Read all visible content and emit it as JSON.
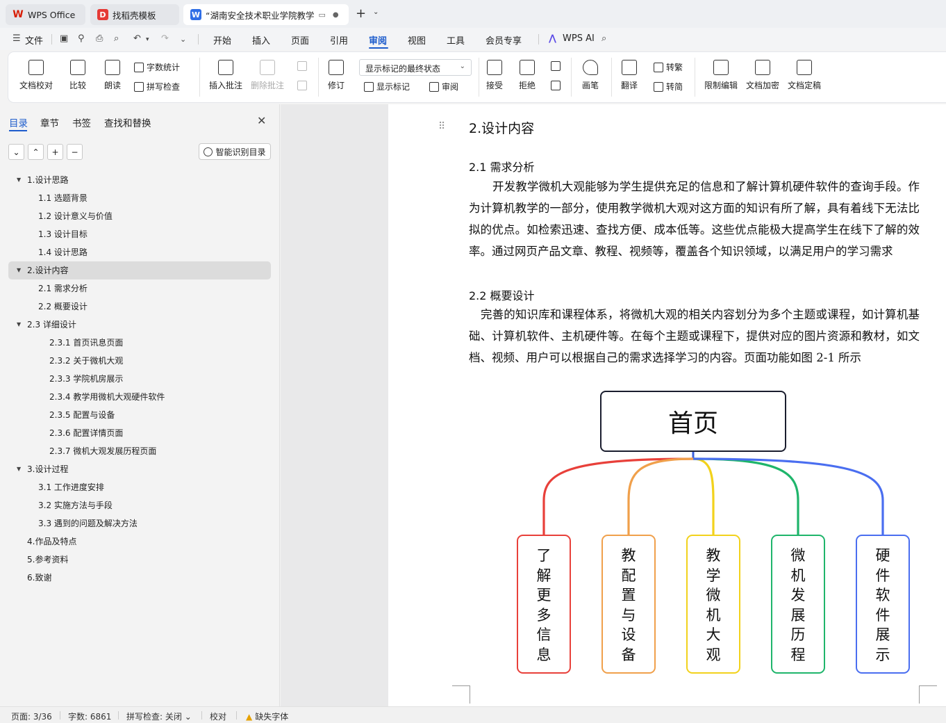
{
  "tabs": [
    {
      "label": "WPS Office",
      "icon": "wps-logo-icon"
    },
    {
      "label": "找稻壳模板",
      "icon": "docer-icon"
    },
    {
      "label": "“湖南安全技术职业学院教学",
      "icon": "word-doc-icon"
    }
  ],
  "menu": {
    "file": "文件",
    "items": [
      "开始",
      "插入",
      "页面",
      "引用",
      "审阅",
      "视图",
      "工具",
      "会员专享"
    ],
    "active": "审阅",
    "ai": "WPS AI"
  },
  "ribbon": {
    "doc_check": "文档校对",
    "compare": "比较",
    "read_aloud": "朗读",
    "word_count": "字数统计",
    "spell_check": "拼写检查",
    "insert_comment": "插入批注",
    "delete_comment": "删除批注",
    "revise": "修订",
    "display_mode": "显示标记的最终状态",
    "show_markup": "显示标记",
    "review": "审阅",
    "accept": "接受",
    "reject": "拒绝",
    "pen": "画笔",
    "translate": "翻译",
    "to_traditional": "转繁",
    "to_simplified": "转简",
    "restrict_edit": "限制编辑",
    "encrypt": "文档加密",
    "finalize": "文档定稿"
  },
  "nav": {
    "tabs": [
      "目录",
      "章节",
      "书签",
      "查找和替换"
    ],
    "smart_toc": "智能识别目录",
    "toc": [
      {
        "text": "1.设计思路",
        "level": 1,
        "expanded": true
      },
      {
        "text": "1.1 选题背景",
        "level": 2
      },
      {
        "text": "1.2 设计意义与价值",
        "level": 2
      },
      {
        "text": "1.3 设计目标",
        "level": 2
      },
      {
        "text": "1.4 设计思路",
        "level": 2
      },
      {
        "text": "2.设计内容",
        "level": 1,
        "expanded": true,
        "selected": true
      },
      {
        "text": "2.1 需求分析",
        "level": 2
      },
      {
        "text": "2.2 概要设计",
        "level": 2
      },
      {
        "text": "2.3 详细设计",
        "level": 1,
        "expanded": true
      },
      {
        "text": "2.3.1 首页讯息页面",
        "level": 3
      },
      {
        "text": "2.3.2 关于微机大观",
        "level": 3
      },
      {
        "text": "2.3.3 学院机房展示",
        "level": 3
      },
      {
        "text": "2.3.4 教学用微机大观硬件软件",
        "level": 3
      },
      {
        "text": "2.3.5 配置与设备",
        "level": 3
      },
      {
        "text": "2.3.6 配置详情页面",
        "level": 3
      },
      {
        "text": "2.3.7 微机大观发展历程页面",
        "level": 3
      },
      {
        "text": "3.设计过程",
        "level": 1,
        "expanded": true
      },
      {
        "text": "3.1 工作进度安排",
        "level": 2
      },
      {
        "text": "3.2 实施方法与手段",
        "level": 2
      },
      {
        "text": "3.3 遇到的问题及解决方法",
        "level": 2
      },
      {
        "text": "4.作品及特点",
        "level": 1
      },
      {
        "text": "5.参考资料",
        "level": 1
      },
      {
        "text": "6.致谢",
        "level": 1
      }
    ]
  },
  "document": {
    "heading": "2.设计内容",
    "s21_title": "2.1 需求分析",
    "s21_body": "开发教学微机大观能够为学生提供充足的信息和了解计算机硬件软件的查询手段。作为计算机教学的一部分，使用教学微机大观对这方面的知识有所了解，具有着线下无法比拟的优点。如检索迅速、查找方便、成本低等。这些优点能极大提高学生在线下了解的效率。通过网页产品文章、教程、视频等，覆盖各个知识领域，以满足用户的学习需求",
    "s22_title": "2.2 概要设计",
    "s22_body": "完善的知识库和课程体系，将微机大观的相关内容划分为多个主题或课程，如计算机基础、计算机软件、主机硬件等。在每个主题或课程下，提供对应的图片资源和教材，如文档、视频、用户可以根据自己的需求选择学习的内容。页面功能如图 2-1 所示",
    "diagram": {
      "root": "首页",
      "children": [
        {
          "text": "了解更多信息",
          "color": "#e8403a"
        },
        {
          "text": "教配置与设备",
          "color": "#f0a04b"
        },
        {
          "text": "教学微机大观",
          "color": "#f2d21c"
        },
        {
          "text": "微机发展历程",
          "color": "#1fb56b"
        },
        {
          "text": "硬件软件展示",
          "color": "#4a6ef0"
        }
      ]
    }
  },
  "status": {
    "page": "页面: 3/36",
    "words": "字数: 6861",
    "spell": "拼写检查: 关闭",
    "proof": "校对",
    "missing_font": "缺失字体"
  }
}
